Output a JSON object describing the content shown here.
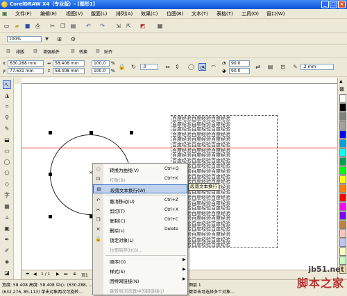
{
  "window": {
    "title": "CorelDRAW X4（专业版）- [图形1]",
    "min": "_",
    "max": "□",
    "close": "×"
  },
  "menu": [
    "文件(F)",
    "编辑(E)",
    "视图(V)",
    "版面(L)",
    "排列(A)",
    "效果(C)",
    "位图(B)",
    "文本(T)",
    "表格(T)",
    "工具(O)",
    "窗口(W)"
  ],
  "zoom": "100%",
  "toolbar3": {
    "tab1": "排版",
    "tab2": "增强插件",
    "tab3": "转换",
    "tab4": "贴齐"
  },
  "props": {
    "x": "630.288 mm",
    "y": "77.631 mm",
    "w": "58.408 mm",
    "h": "58.408 mm",
    "sx": "100.0",
    "sy": "100.0",
    "pct": "%",
    "rot": ".0",
    "ang1": "90.0",
    "ang2": "90.0",
    "outline": ".2 mm"
  },
  "canvas": {
    "text_lines": [
      "百度经验百度经验百度经验",
      "百度经验百度经验百度经验",
      "百度经验百度经验百度经验",
      "百度经验百度经验百度经验",
      "百度经验百度经验百度经验",
      "百度经验百度经验百度经验",
      "百度经验百度经验百度经验",
      "百度经验百度经验百度经验",
      "百度经验百度经验百度经验",
      "百度经验百度经验百度经验",
      "百度经验百度经验百度经验",
      "百度经验百度经验百度经验",
      "百度经验百度经验百度经验",
      "百度经验百度经验百度经验",
      "百度经验百度经验百度经验",
      "百度经验百度经验百度经验",
      "百度经验百度经验百度经验",
      "百度经验百度经验百度经验",
      "百度经验百度经验百度经验",
      "百度经验百度经验百度经验",
      "百度经验百度经验百度经验",
      "百度经验百度经验百度经验",
      "百度经验百度经验百度经验",
      "百度经验百度经验百度经验",
      "百度经验百度经验百度经验"
    ],
    "tooltip": "段落文本换行",
    "page_nav": "1 / 1",
    "page_tab": "页1",
    "layer": "图层 1"
  },
  "context_menu": [
    {
      "label": "转换为曲线(V)",
      "key": "Ctrl+Q",
      "icon": "convert-curve-icon"
    },
    {
      "label": "打散(B)",
      "key": "Ctrl+K",
      "icon": "break-apart-icon",
      "disabled": true
    },
    {
      "label": "段落文本换行(W)",
      "key": "",
      "icon": "text-wrap-icon",
      "highlighted": true
    },
    {
      "label": "撤消移动(U)",
      "key": "Ctrl+Z",
      "icon": "undo-icon"
    },
    {
      "label": "剪切(T)",
      "key": "Ctrl+X",
      "icon": "cut-icon"
    },
    {
      "label": "复制(C)",
      "key": "Ctrl+C",
      "icon": "copy-icon"
    },
    {
      "label": "删除(L)",
      "key": "Delete",
      "icon": "delete-icon"
    },
    {
      "label": "锁定对象(L)",
      "key": "",
      "icon": "lock-icon"
    },
    {
      "label": "位图另存为(S)...",
      "key": "",
      "icon": "",
      "disabled": true
    },
    {
      "label": "顺序(O)",
      "key": "",
      "icon": "",
      "submenu": true
    },
    {
      "label": "样式(S)",
      "key": "",
      "icon": "",
      "submenu": true
    },
    {
      "label": "因特网链接(N)",
      "key": "",
      "icon": "",
      "submenu": true
    },
    {
      "label": "跳转到浏览器中的超链接(J)",
      "key": "",
      "icon": "",
      "disabled": true
    }
  ],
  "status": {
    "line1": "宽度: 58.408  高度: 58.408  中心: (630.288, ...",
    "line2": "(632.276, 85.113)    单击对象两次可旋转...",
    "hint": "键单击可选择多个对象..."
  },
  "watermark": {
    "site": "jb51.net",
    "name": "脚本之家"
  },
  "palette_colors": [
    "#ffffff",
    "#000000",
    "#7f7f7f",
    "#a0a0a0",
    "#0000ff",
    "#00a0e0",
    "#00ffff",
    "#00a050",
    "#00ff00",
    "#ffff00",
    "#ff8000",
    "#ff0000",
    "#ff00ff",
    "#8000ff",
    "#c08040",
    "#ffc0c0",
    "#c0c0ff",
    "#ffffc0",
    "#c0ffc0",
    "#ffe0a0"
  ]
}
